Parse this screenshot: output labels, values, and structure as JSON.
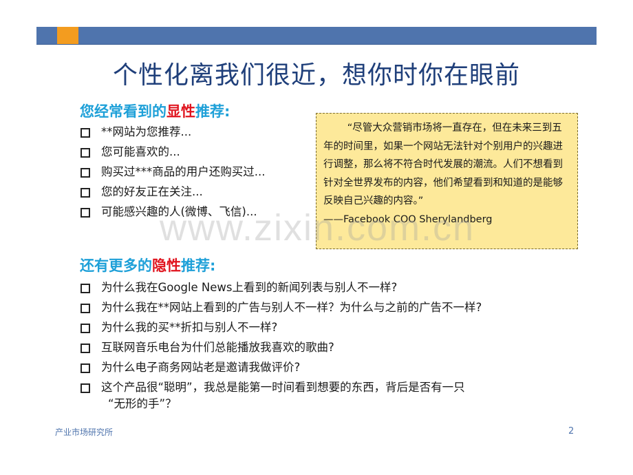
{
  "header": {
    "title": "个性化离我们很近，想你时你在眼前"
  },
  "explicit": {
    "heading_pre": "您经常看到的",
    "heading_hl": "显性",
    "heading_post": "推荐:",
    "items": [
      "**网站为您推荐...",
      "您可能喜欢的...",
      "购买过***商品的用户还购买过...",
      "您的好友正在关注...",
      "可能感兴趣的人(微博、飞信)..."
    ]
  },
  "implicit": {
    "heading_pre": "还有更多的",
    "heading_hl": "隐性",
    "heading_post": "推荐:",
    "items": [
      "为什么我在Google News上看到的新闻列表与别人不一样?",
      "为什么我在**网站上看到的广告与别人不一样？为什么与之前的广告不一样?",
      "为什么我的买**折扣与别人不一样?",
      "互联网音乐电台为什们总能播放我喜欢的歌曲?",
      "为什么电子商务网站老是邀请我做评价?",
      "这个产品很“聪明”，我总是能第一时间看到想要的东西，背后是否有一只"
    ],
    "last_item_cont": "“无形的手”？"
  },
  "quote": {
    "text": "“尽管大众营销市场将一直存在，但在未来三到五年的时间里，如果一个网站无法针对个别用户的兴趣进行调整，那么将不符合时代发展的潮流。人们不想看到针对全世界发布的内容，他们希望看到和知道的是能够反映自己兴趣的内容。”",
    "attribution": "——Facebook COO Sherylandberg"
  },
  "watermark": "www.zixin.com.cn",
  "footer": {
    "left": "产业市场研究所",
    "page": "2"
  },
  "colors": {
    "bar": "#4f74ad",
    "bar_accent": "#f39c1f",
    "title": "#1f3f7a",
    "heading": "#1ea0d8",
    "highlight": "#e0141e",
    "quote_bg": "#fde99a"
  }
}
